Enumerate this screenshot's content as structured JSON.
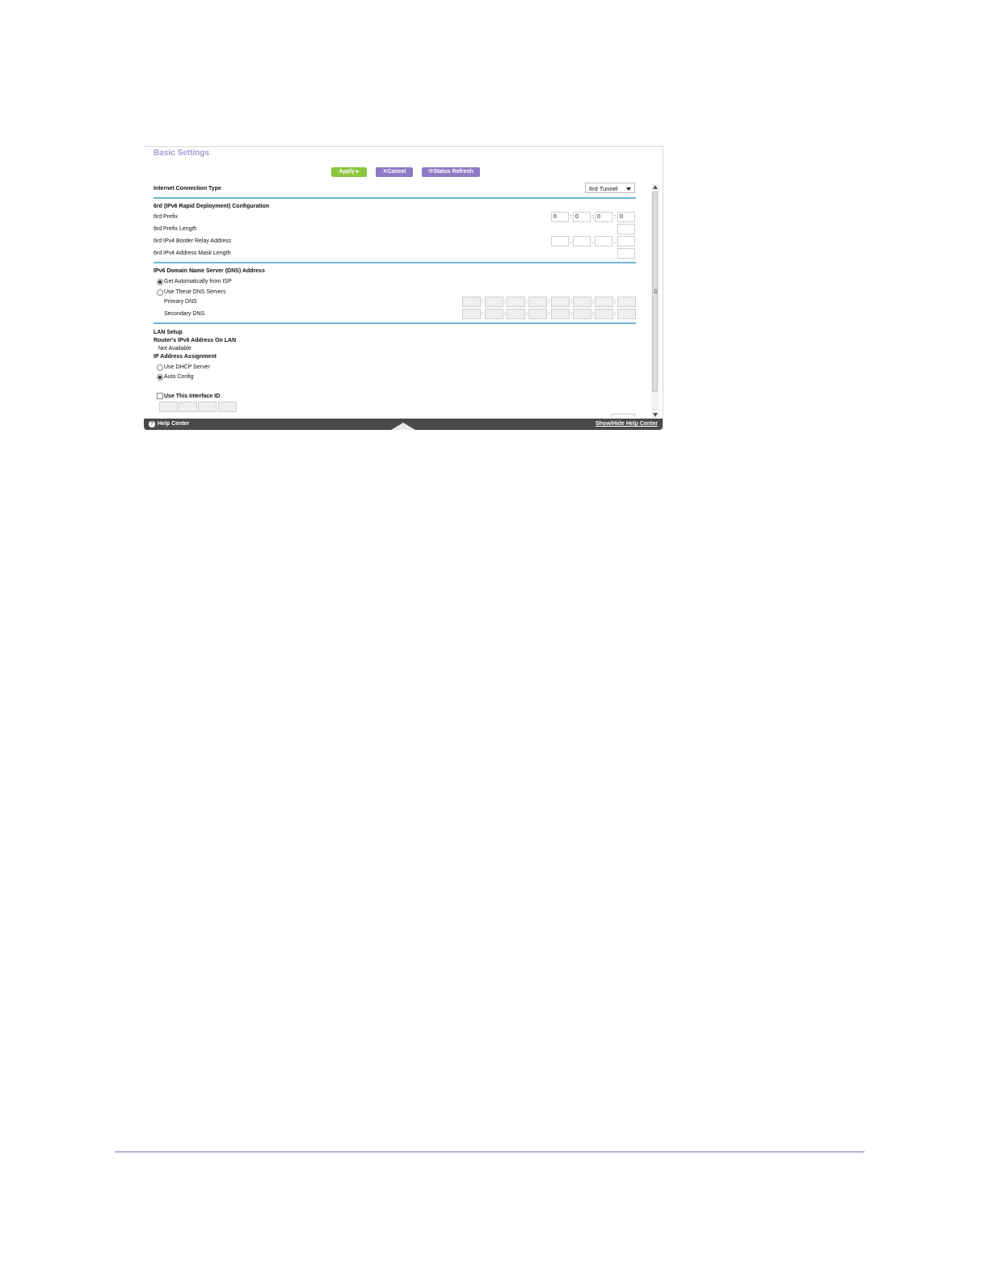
{
  "page": {
    "title": "Basic Settings"
  },
  "toolbar": {
    "apply": "Apply ▸",
    "cancel": "✕Cancel",
    "refresh": "⟳Status Refresh"
  },
  "connection": {
    "label": "Internet Connection Type",
    "selected": "6rd Tunnel"
  },
  "sixrd": {
    "section": "6rd (IPv6 Rapid Deployment) Configuration",
    "prefix_label": "6rd Prefix",
    "prefix_values": [
      "0",
      "0",
      "0",
      "0"
    ],
    "prefix_length_label": "6rd Prefix Length",
    "relay_label": "6rd IPv4 Border Relay Address",
    "mask_label": "6rd IPv4 Address Mask Length"
  },
  "dns": {
    "section": "IPv6 Domain Name Server (DNS) Address",
    "auto": "Get Automatically from ISP",
    "manual": "Use These DNS Servers",
    "primary": "Primary DNS",
    "secondary": "Secondary DNS"
  },
  "lan": {
    "section": "LAN Setup",
    "router_label": "Router's IPv6 Address On LAN",
    "router_value": "Not Available",
    "assign_label": "IP Address Assignment",
    "dhcp": "Use DHCP Server",
    "auto": "Auto Config",
    "interface_id": "Use This Interface ID"
  },
  "footer": {
    "help": "Help Center",
    "toggle": "Show/Hide Help Center"
  },
  "colors": {
    "accent": "#8c7cc6",
    "apply": "#8dc63f",
    "rule": "#6cb7cf",
    "title": "#a59ad0"
  }
}
